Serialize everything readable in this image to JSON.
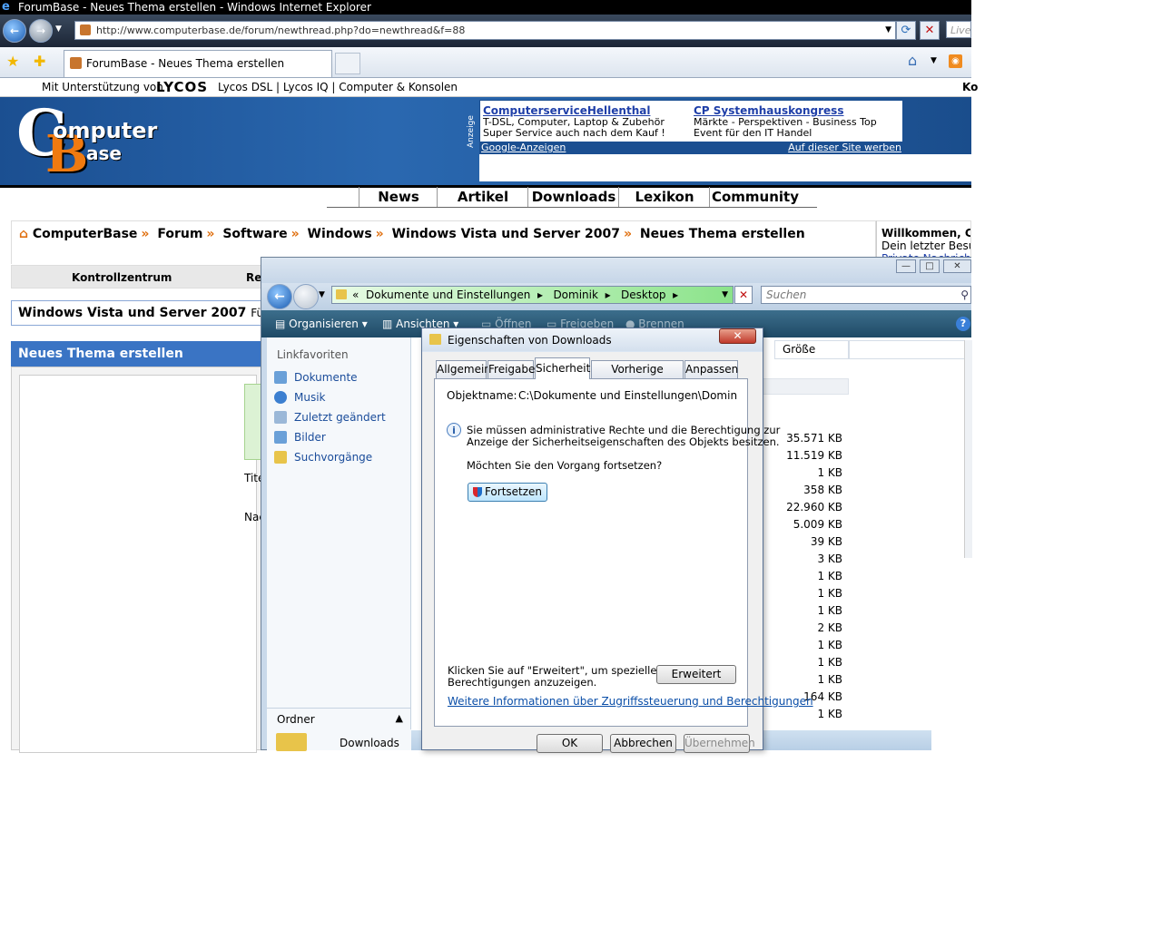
{
  "ie": {
    "window_title": "ForumBase - Neues Thema erstellen - Windows Internet Explorer",
    "url": "http://www.computerbase.de/forum/newthread.php?do=newthread&f=88",
    "search_placeholder": "Live",
    "tab_title": "ForumBase - Neues Thema erstellen"
  },
  "lycos_bar": {
    "support_text": "Mit Unterstützung von",
    "logo_text": "LYCOS",
    "links": "Lycos DSL | Lycos IQ | Computer & Konsolen",
    "right_cut": "Ko"
  },
  "logo": {
    "c": "C",
    "b": "B",
    "omputer": "omputer",
    "ase": "ase"
  },
  "ads": {
    "label": "Anzeige",
    "ad1_title": "ComputerserviceHellenthal",
    "ad1_line1": "T-DSL, Computer, Laptop & Zubehör",
    "ad1_line2": "Super Service auch nach dem Kauf !",
    "ad2_title": "CP Systemhauskongress",
    "ad2_line1": "Märkte - Perspektiven - Business Top",
    "ad2_line2": "Event für den IT Handel",
    "footer_left": "Google-Anzeigen",
    "footer_right": "Auf dieser Site werben"
  },
  "nav": [
    "News",
    "Artikel",
    "Downloads",
    "Lexikon",
    "Community"
  ],
  "breadcrumb": [
    "ComputerBase",
    "Forum",
    "Software",
    "Windows",
    "Windows Vista und Server 2007",
    "Neues Thema erstellen"
  ],
  "welcome": {
    "line1": "Willkommen, CC",
    "line2": "Dein letzter Besu",
    "line3": "Private Nachricht"
  },
  "kontroll": {
    "label": "Kontrollzentrum",
    "cut": "Re"
  },
  "forum_title": {
    "title": "Windows Vista und Server 2007",
    "subtitle": "Für Frag"
  },
  "new_thread": {
    "header": "Neues Thema erstellen",
    "title_label": "Tite",
    "message_label": "Nac"
  },
  "explorer": {
    "path": [
      "Dokumente und Einstellungen",
      "Dominik",
      "Desktop"
    ],
    "search_placeholder": "Suchen",
    "toolbar": [
      "Organisieren",
      "Ansichten",
      "Öffnen",
      "Freigeben",
      "Brennen"
    ],
    "favorites_header": "Linkfavoriten",
    "favorites": [
      "Dokumente",
      "Musik",
      "Zuletzt geändert",
      "Bilder",
      "Suchvorgänge"
    ],
    "folders_label": "Ordner",
    "selected_folder": "Downloads",
    "size_column": "Größe",
    "sizes": [
      "35.571 KB",
      "11.519 KB",
      "1 KB",
      "358 KB",
      "22.960 KB",
      "5.009 KB",
      "39 KB",
      "3 KB",
      "1 KB",
      "1 KB",
      "1 KB",
      "2 KB",
      "1 KB",
      "1 KB",
      "1 KB",
      "164 KB",
      "1 KB"
    ]
  },
  "dialog": {
    "title": "Eigenschaften von Downloads",
    "tabs": [
      "Allgemein",
      "Freigabe",
      "Sicherheit",
      "Vorherige Versionen",
      "Anpassen"
    ],
    "selected_tab": "Sicherheit",
    "object_label": "Objektname:",
    "object_value": "C:\\Dokumente und Einstellungen\\Dominik\\Desktop",
    "info_line1": "Sie müssen administrative Rechte und die Berechtigung zur",
    "info_line2": "Anzeige der Sicherheitseigenschaften des Objekts besitzen.",
    "question": "Möchten Sie den Vorgang fortsetzen?",
    "continue_button": "Fortsetzen",
    "advanced_line1": "Klicken Sie auf \"Erweitert\", um spezielle",
    "advanced_line2": "Berechtigungen anzuzeigen.",
    "advanced_button": "Erweitert",
    "info_link": "Weitere Informationen über Zugriffssteuerung und Berechtigungen",
    "ok": "OK",
    "cancel": "Abbrechen",
    "apply": "Übernehmen"
  }
}
